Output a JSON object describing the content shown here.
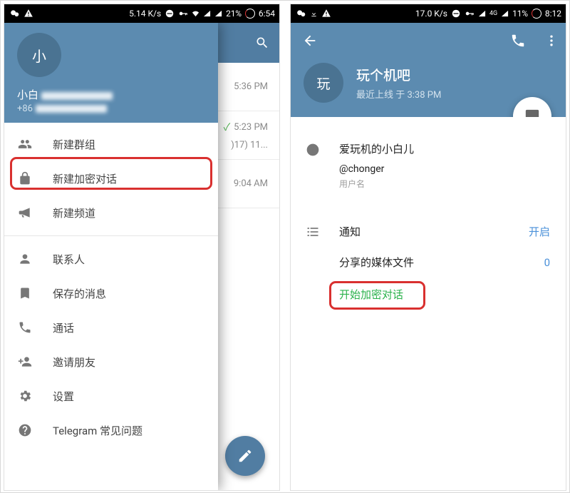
{
  "left": {
    "status": {
      "speed": "5.14 K/s",
      "battery_pct": "21%",
      "time": "6:54"
    },
    "bg_times": {
      "t1": "5:36 PM",
      "t2": "5:23 PM",
      "t2_sub": ")17) 11...",
      "t3": "9:04 AM"
    },
    "drawer": {
      "avatar_char": "小",
      "name": "小白",
      "phone_prefix": "+86",
      "items": {
        "new_group": "新建群组",
        "new_secret": "新建加密对话",
        "new_channel": "新建频道",
        "contacts": "联系人",
        "saved": "保存的消息",
        "calls": "通话",
        "invite": "邀请朋友",
        "settings": "设置",
        "faq": "Telegram 常见问题"
      }
    }
  },
  "right": {
    "status": {
      "speed": "17.0 K/s",
      "net_label": "4G",
      "battery_pct": "11%",
      "time": "8:12"
    },
    "profile": {
      "avatar_char": "玩",
      "title": "玩个机吧",
      "last_seen": "最近上线 于 3:38 PM"
    },
    "info": {
      "name": "爱玩机的小白儿",
      "username": "@chonger",
      "username_hint": "用户名"
    },
    "options": {
      "notifications_label": "通知",
      "notifications_value": "开启",
      "shared_media_label": "分享的媒体文件",
      "shared_media_value": "0",
      "start_secret": "开始加密对话"
    }
  }
}
